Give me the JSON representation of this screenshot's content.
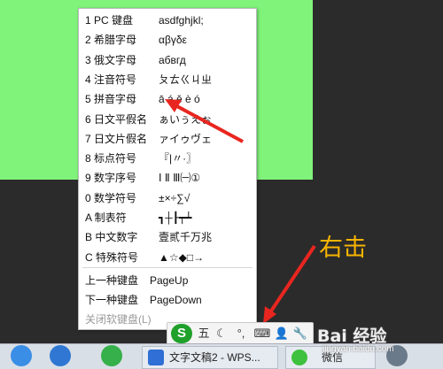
{
  "menu": {
    "items": [
      {
        "label": "1 PC 键盘",
        "sample": "asdfghjkl;"
      },
      {
        "label": "2 希腊字母",
        "sample": "αβγδε"
      },
      {
        "label": "3 俄文字母",
        "sample": "абвгд"
      },
      {
        "label": "4 注音符号",
        "sample": "ㄆㄊㄍㄐㄓ"
      },
      {
        "label": "5 拼音字母",
        "sample": "ā á ě è ó"
      },
      {
        "label": "6 日文平假名",
        "sample": "ぁいぅえぉ"
      },
      {
        "label": "7 日文片假名",
        "sample": "ァイゥヴェ"
      },
      {
        "label": "8 标点符号",
        "sample": "『|〃·〗"
      },
      {
        "label": "9 数字序号",
        "sample": "Ⅰ Ⅱ Ⅲ㈠①"
      },
      {
        "label": "0 数学符号",
        "sample": "±×÷∑√"
      },
      {
        "label": "A 制表符",
        "sample": "┓┼┠┯┷"
      },
      {
        "label": "B 中文数字",
        "sample": "壹贰千万兆"
      },
      {
        "label": "C 特殊符号",
        "sample": "▲☆◆□→"
      }
    ],
    "prev": {
      "label": "上一种键盘",
      "sample": "PageUp"
    },
    "next": {
      "label": "下一种键盘",
      "sample": "PageDown"
    },
    "close": {
      "label": "关闭软键盘(L)"
    }
  },
  "ime_bar": {
    "logo": "S",
    "mode": "五",
    "moon": "☾",
    "punct": "°,",
    "keyboard": "⌨",
    "user": "👤",
    "wrench": "🔧"
  },
  "annotation": {
    "text": "右击"
  },
  "taskbar": {
    "wps_window": "文字文稿2 - WPS...",
    "wechat": "微信"
  },
  "watermark": {
    "brand": "Bai 经验",
    "site": "jingyan.baidu.com"
  },
  "colors": {
    "green_window": "#80f37b",
    "arrow": "#e8261f",
    "annotation": "#f6b400"
  }
}
